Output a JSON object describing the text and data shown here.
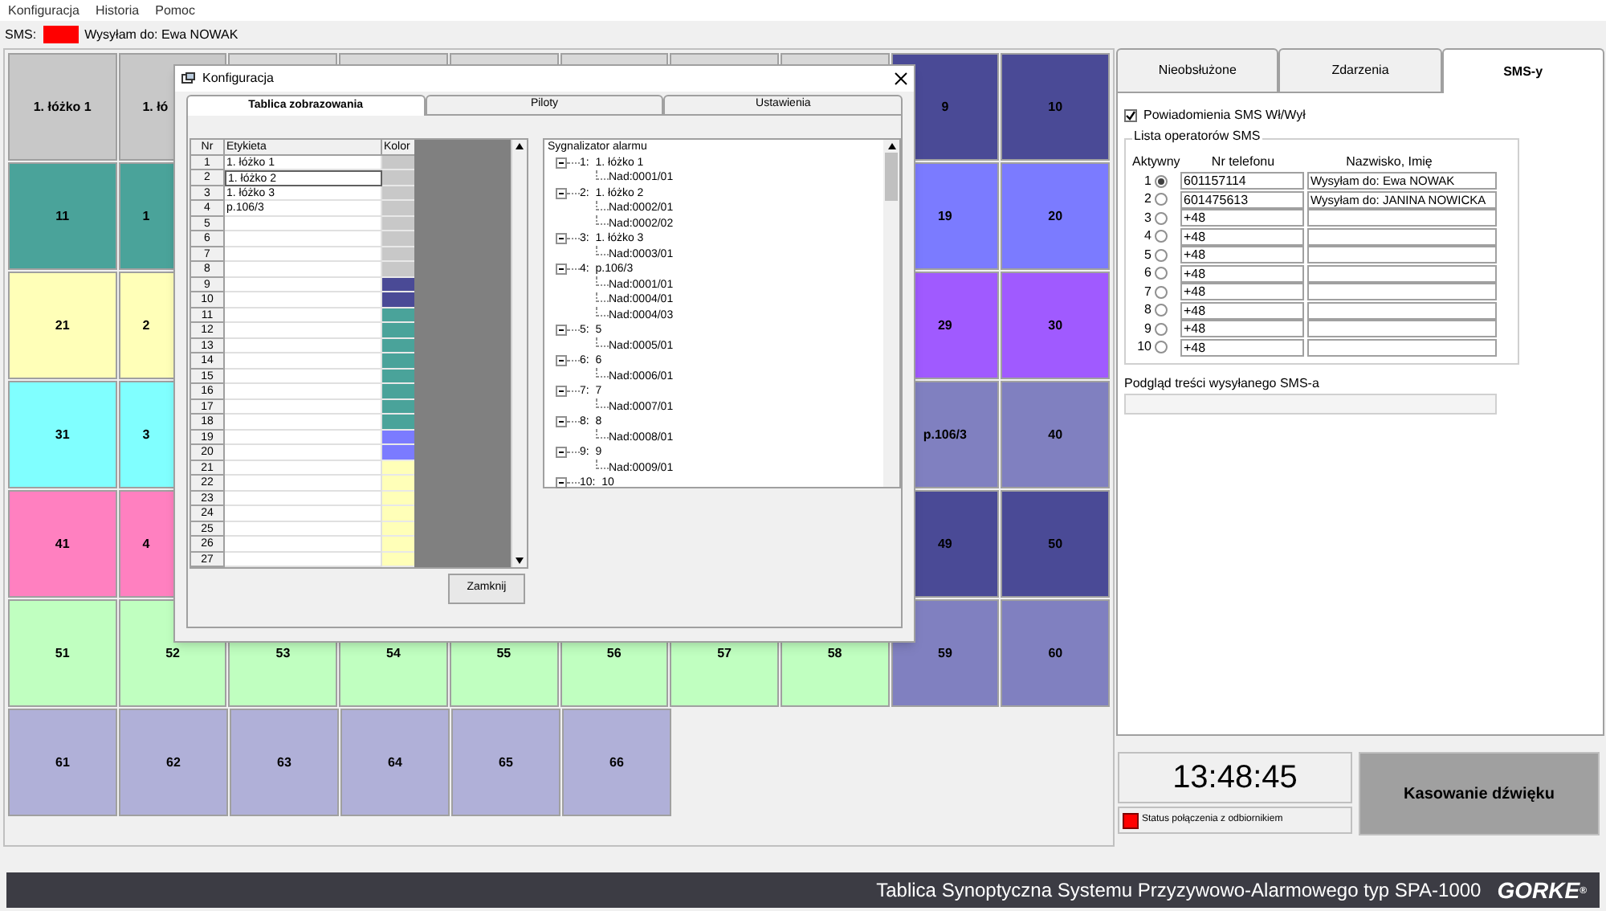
{
  "menu": [
    "Konfiguracja",
    "Historia",
    "Pomoc"
  ],
  "sms_bar": {
    "label": "SMS:",
    "alarm": true,
    "message": "Wysyłam do: Ewa NOWAK"
  },
  "grid": {
    "rows": [
      {
        "kind": "split",
        "left": [
          {
            "label": "1. łóżko 1",
            "color": "#c8c8c8",
            "clipped": false
          },
          {
            "label": "1. łó",
            "color": "#c8c8c8",
            "clipped": true
          }
        ],
        "right": [
          {
            "label": "9",
            "color": "#4a4a96",
            "clipped": false
          },
          {
            "label": "10",
            "color": "#4a4a96",
            "clipped": false
          }
        ]
      },
      {
        "kind": "split",
        "left": [
          {
            "label": "11",
            "color": "#4aa39a",
            "clipped": false
          },
          {
            "label": "1",
            "color": "#4aa39a",
            "clipped": true
          }
        ],
        "right": [
          {
            "label": "19",
            "color": "#7b7bff",
            "clipped": false
          },
          {
            "label": "20",
            "color": "#7b7bff",
            "clipped": false
          }
        ]
      },
      {
        "kind": "split",
        "left": [
          {
            "label": "21",
            "color": "#ffffb8",
            "clipped": false
          },
          {
            "label": "2",
            "color": "#ffffb8",
            "clipped": true
          }
        ],
        "right": [
          {
            "label": "29",
            "color": "#a05aff",
            "clipped": false
          },
          {
            "label": "30",
            "color": "#a05aff",
            "clipped": false
          }
        ]
      },
      {
        "kind": "split",
        "left": [
          {
            "label": "31",
            "color": "#80ffff",
            "clipped": false
          },
          {
            "label": "3",
            "color": "#80ffff",
            "clipped": true
          }
        ],
        "right": [
          {
            "label": "p.106/3",
            "color": "#8080c0",
            "clipped": false
          },
          {
            "label": "40",
            "color": "#8080c0",
            "clipped": false
          }
        ]
      },
      {
        "kind": "split",
        "left": [
          {
            "label": "41",
            "color": "#ff80c0",
            "clipped": false
          },
          {
            "label": "4",
            "color": "#ff80c0",
            "clipped": true
          }
        ],
        "right": [
          {
            "label": "49",
            "color": "#4a4a96",
            "clipped": false
          },
          {
            "label": "50",
            "color": "#4a4a96",
            "clipped": false
          }
        ]
      },
      {
        "kind": "full",
        "tiles": [
          {
            "label": "51",
            "color": "#c0ffc0"
          },
          {
            "label": "52",
            "color": "#c0ffc0"
          },
          {
            "label": "53",
            "color": "#c0ffc0"
          },
          {
            "label": "54",
            "color": "#c0ffc0"
          },
          {
            "label": "55",
            "color": "#c0ffc0"
          },
          {
            "label": "56",
            "color": "#c0ffc0"
          },
          {
            "label": "57",
            "color": "#c0ffc0"
          },
          {
            "label": "58",
            "color": "#c0ffc0"
          },
          {
            "label": "59",
            "color": "#8080c0"
          },
          {
            "label": "60",
            "color": "#8080c0"
          }
        ]
      },
      {
        "kind": "full",
        "tiles": [
          {
            "label": "61",
            "color": "#b0b0d8"
          },
          {
            "label": "62",
            "color": "#b0b0d8"
          },
          {
            "label": "63",
            "color": "#b0b0d8"
          },
          {
            "label": "64",
            "color": "#b0b0d8"
          },
          {
            "label": "65",
            "color": "#b0b0d8"
          },
          {
            "label": "66",
            "color": "#b0b0d8"
          }
        ]
      }
    ]
  },
  "right_panel": {
    "tabs": [
      {
        "label": "Nieobsłużone",
        "selected": false
      },
      {
        "label": "Zdarzenia",
        "selected": false
      },
      {
        "label": "SMS-y",
        "selected": true
      }
    ],
    "notifications": {
      "label": "Powiadomienia SMS Wł/Wył",
      "checked": true
    },
    "operators": {
      "title": "Lista operatorów SMS",
      "columns": [
        "Aktywny",
        "Nr telefonu",
        "Nazwisko, Imię"
      ],
      "rows": [
        {
          "nr": "1",
          "selected": true,
          "phone": "601157114",
          "name": "Wysyłam do: Ewa NOWAK"
        },
        {
          "nr": "2",
          "selected": false,
          "phone": "601475613",
          "name": "Wysyłam do: JANINA NOWICKA"
        },
        {
          "nr": "3",
          "selected": false,
          "phone": "+48"
        },
        {
          "nr": "4",
          "selected": false,
          "phone": "+48"
        },
        {
          "nr": "5",
          "selected": false,
          "phone": "+48"
        },
        {
          "nr": "6",
          "selected": false,
          "phone": "+48"
        },
        {
          "nr": "7",
          "selected": false,
          "phone": "+48"
        },
        {
          "nr": "8",
          "selected": false,
          "phone": "+48"
        },
        {
          "nr": "9",
          "selected": false,
          "phone": "+48"
        },
        {
          "nr": "10",
          "selected": false,
          "phone": "+48"
        }
      ]
    },
    "preview": {
      "label": "Podgląd treści wysyłanego SMS-a"
    },
    "clock": "13:48:45",
    "connection": {
      "label": "Status połączenia z odbiornikiem",
      "connected": false
    },
    "reset_button": "Kasowanie dźwięku"
  },
  "footer": {
    "title": "Tablica Synoptyczna Systemu Przyzywowo-Alarmowego typ SPA-1000",
    "logo": "GORKE",
    "logo_mark": "®"
  },
  "dialog": {
    "title": "Konfiguracja",
    "tabs": [
      {
        "label": "Tablica zobrazowania",
        "selected": true
      },
      {
        "label": "Piloty",
        "selected": false
      },
      {
        "label": "Ustawienia",
        "selected": false
      }
    ],
    "table": {
      "columns": [
        "Nr",
        "Etykieta",
        "Kolor"
      ],
      "rows": [
        {
          "nr": "1",
          "label": "1. łóżko 1",
          "color": "#c8c8c8",
          "selected": false
        },
        {
          "nr": "2",
          "label": "1. łóżko 2",
          "color": "#c8c8c8",
          "selected": true
        },
        {
          "nr": "3",
          "label": "1. łóżko 3",
          "color": "#c8c8c8",
          "selected": false
        },
        {
          "nr": "4",
          "label": "p.106/3",
          "color": "#c8c8c8",
          "selected": false
        },
        {
          "nr": "5",
          "color": "#c8c8c8",
          "selected": false
        },
        {
          "nr": "6",
          "color": "#c8c8c8",
          "selected": false
        },
        {
          "nr": "7",
          "color": "#c8c8c8",
          "selected": false
        },
        {
          "nr": "8",
          "color": "#c8c8c8",
          "selected": false
        },
        {
          "nr": "9",
          "color": "#4a4a96",
          "selected": false
        },
        {
          "nr": "10",
          "color": "#4a4a96",
          "selected": false
        },
        {
          "nr": "11",
          "color": "#4aa39a",
          "selected": false
        },
        {
          "nr": "12",
          "color": "#4aa39a",
          "selected": false
        },
        {
          "nr": "13",
          "color": "#4aa39a",
          "selected": false
        },
        {
          "nr": "14",
          "color": "#4aa39a",
          "selected": false
        },
        {
          "nr": "15",
          "color": "#4aa39a",
          "selected": false
        },
        {
          "nr": "16",
          "color": "#4aa39a",
          "selected": false
        },
        {
          "nr": "17",
          "color": "#4aa39a",
          "selected": false
        },
        {
          "nr": "18",
          "color": "#4aa39a",
          "selected": false
        },
        {
          "nr": "19",
          "color": "#7b7bff",
          "selected": false
        },
        {
          "nr": "20",
          "color": "#7b7bff",
          "selected": false
        },
        {
          "nr": "21",
          "color": "#ffffb8",
          "selected": false
        },
        {
          "nr": "22",
          "color": "#ffffb8",
          "selected": false
        },
        {
          "nr": "23",
          "color": "#ffffb8",
          "selected": false
        },
        {
          "nr": "24",
          "color": "#ffffb8",
          "selected": false
        },
        {
          "nr": "25",
          "color": "#ffffb8",
          "selected": false
        },
        {
          "nr": "26",
          "color": "#ffffb8",
          "selected": false
        },
        {
          "nr": "27",
          "color": "#ffffb8",
          "selected": false
        }
      ]
    },
    "tree": {
      "title": "Sygnalizator alarmu",
      "nodes": [
        {
          "label": "1:  1. łóżko 1",
          "expanded": true,
          "children": [
            "Nad:0001/01"
          ]
        },
        {
          "label": "2:  1. łóżko 2",
          "expanded": true,
          "children": [
            "Nad:0002/01",
            "Nad:0002/02"
          ]
        },
        {
          "label": "3:  1. łóżko 3",
          "expanded": true,
          "children": [
            "Nad:0003/01"
          ]
        },
        {
          "label": "4:  p.106/3",
          "expanded": true,
          "children": [
            "Nad:0001/01",
            "Nad:0004/01",
            "Nad:0004/03"
          ]
        },
        {
          "label": "5:  5",
          "expanded": true,
          "children": [
            "Nad:0005/01"
          ]
        },
        {
          "label": "6:  6",
          "expanded": true,
          "children": [
            "Nad:0006/01"
          ]
        },
        {
          "label": "7:  7",
          "expanded": true,
          "children": [
            "Nad:0007/01"
          ]
        },
        {
          "label": "8:  8",
          "expanded": true,
          "children": [
            "Nad:0008/01"
          ]
        },
        {
          "label": "9:  9",
          "expanded": true,
          "children": [
            "Nad:0009/01"
          ]
        },
        {
          "label": "10:  10",
          "expanded": true
        }
      ]
    },
    "close_button": "Zamknij"
  }
}
